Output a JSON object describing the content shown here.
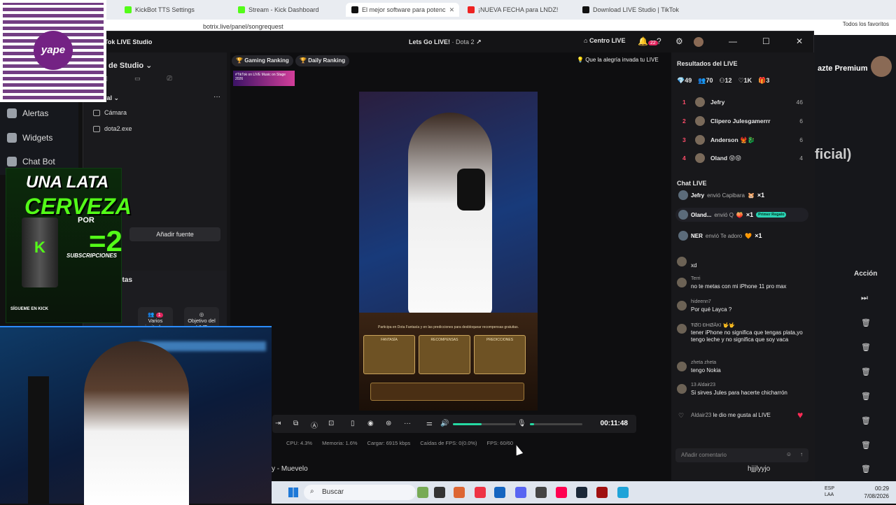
{
  "browser": {
    "tabs": [
      {
        "label": "KickBot TTS Settings",
        "active": false
      },
      {
        "label": "Stream - Kick Dashboard",
        "active": false
      },
      {
        "label": "El mejor software para potenc",
        "active": true
      },
      {
        "label": "¡NUEVA FECHA para LNDZ!",
        "active": false
      },
      {
        "label": "Download LIVE Studio | TikTok",
        "active": false
      }
    ],
    "url": "botrix.live/panel/songrequest",
    "favorites": "Todos los favoritos"
  },
  "botrix": {
    "sidebar": [
      "Alertas",
      "Widgets",
      "Chat Bot"
    ],
    "premium": "azte Premium",
    "video_title": "ficial)",
    "action_header": "Acción"
  },
  "studio": {
    "app_title": "Tok LIVE Studio",
    "stream_title": "Lets Go LIVE!",
    "stream_game": "· Dota 2",
    "centro": "Centro LIVE",
    "notif_count": "22",
    "scene_title": "de Studio",
    "section_label": "ral",
    "sources": [
      "Cámara",
      "dota2.exe"
    ],
    "add_source": "Añadir fuente",
    "tools_label": "etas",
    "tools": [
      {
        "label": "Varios invitados",
        "badge": "1"
      },
      {
        "label": "Objetivo del LIVE",
        "badge": ""
      }
    ],
    "rankings": [
      "Gaming Ranking",
      "Daily Ranking"
    ],
    "motto": "Que la alegría invada tu LIVE",
    "event_banner": "#TikTok on LIVE Music on Stage 2026",
    "promo_text": "Participa en Dota Fantasía y en las predicciones para desbloquear recompensas gratuitas.",
    "promo_cards": [
      "FANTASÍA",
      "RECOMPENSAS",
      "PREDICCIONES"
    ],
    "timer": "00:11:48",
    "volume": 0.45,
    "mic_volume": 0.08,
    "stats": [
      "CPU: 4.3%",
      "Memoria: 1.6%",
      "Cargar: 6915 kbps",
      "Caídas de FPS: 0(0.0%)",
      "FPS: 60/60"
    ],
    "results_title": "Resultados del LIVE",
    "results_stats": [
      "49",
      "70",
      "12",
      "1K",
      "3"
    ],
    "ranking": [
      {
        "pos": "1",
        "name": "Jefry",
        "score": "46"
      },
      {
        "pos": "2",
        "name": "Clipero Julesgamerrr",
        "score": "6"
      },
      {
        "pos": "3",
        "name": "Anderson 🐦‍🔥🐉",
        "score": "6"
      },
      {
        "pos": "4",
        "name": "Oland 😝😝",
        "score": "4"
      }
    ],
    "chat_title": "Chat LIVE",
    "gifts": [
      {
        "name": "Jefry",
        "action": "envió Capibara",
        "count": "×1",
        "tag": ""
      },
      {
        "name": "Oland...",
        "action": "envió Q",
        "count": "×1",
        "tag": "Primer Regalo"
      },
      {
        "name": "NER",
        "action": "envió Te adoro",
        "count": "×1",
        "tag": ""
      }
    ],
    "chat": [
      {
        "user": "",
        "msg": "xd"
      },
      {
        "user": "Terri",
        "msg": "no te metas con mi iPhone 11 pro max"
      },
      {
        "user": "hideenn7",
        "msg": "Por qué Layca ?"
      },
      {
        "user": "ŦØŊ ÐHØĀKI 🤟🤟",
        "msg": "tener iPhone no significa que tengas plata,yo tengo leche y no significa que soy vaca"
      },
      {
        "user": "zheta zheta",
        "msg": "tengo Nokia"
      },
      {
        "user": "13 Aldair23",
        "msg": "Si sirves Jules para hacerte chicharrón"
      },
      {
        "user": "Aldair23",
        "msg": "le dio me gusta al LIVE"
      }
    ],
    "chat_placeholder": "Añadir comentario"
  },
  "overlay": {
    "qr_brand": "yape",
    "kick_line1": "UNA LATA",
    "kick_line2": "CERVEZA",
    "kick_por": "POR",
    "kick_num": "=2",
    "kick_subs": "SUBSCRIPCIONES",
    "kick_footer": "SÍGUEME EN KICK"
  },
  "songs": {
    "left": "y - Muevelo",
    "right": "hjjjlyyjo"
  },
  "taskbar": {
    "search": "Buscar",
    "lang": "ESP\nLAA",
    "time": "00:29",
    "date": "7/08/2026"
  },
  "colors": {
    "accent": "#25d9a2",
    "tiktok_red": "#ff4d6a",
    "kick_green": "#53fc18"
  }
}
